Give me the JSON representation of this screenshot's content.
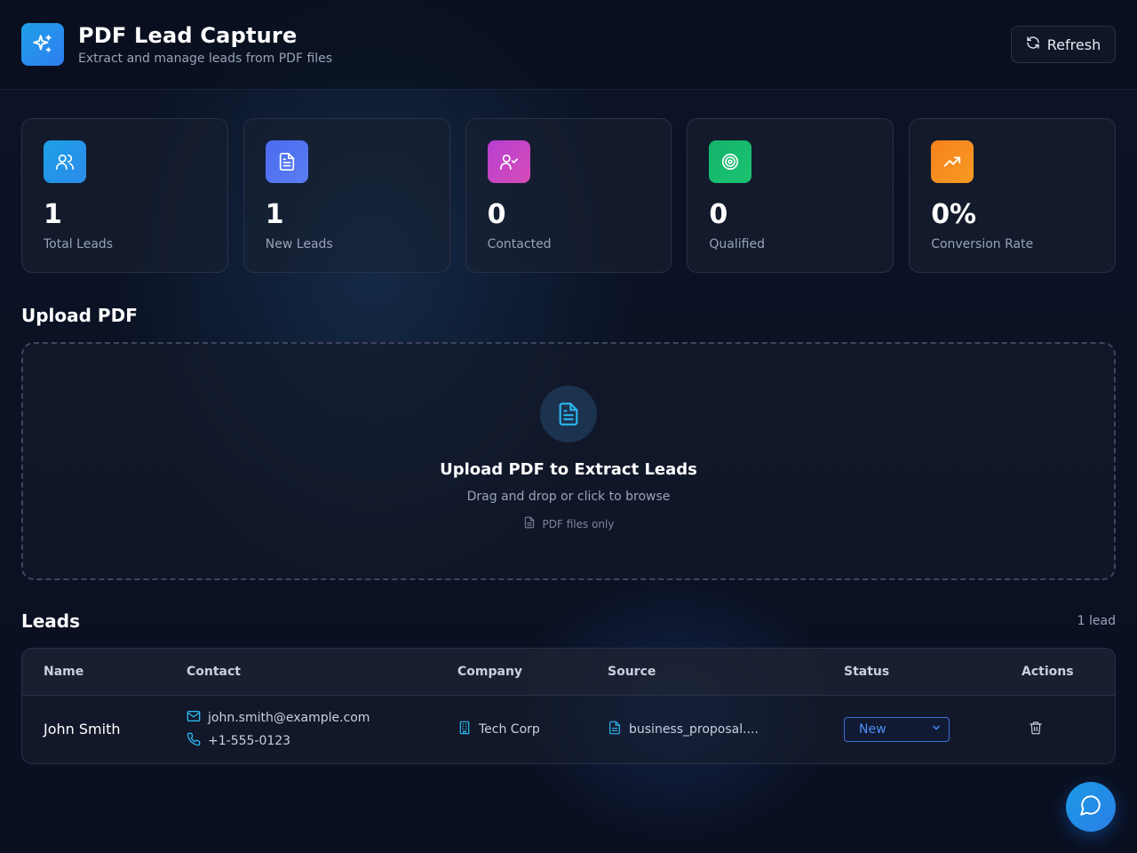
{
  "header": {
    "title": "PDF Lead Capture",
    "subtitle": "Extract and manage leads from PDF files",
    "refresh_label": "Refresh"
  },
  "stats": [
    {
      "value": "1",
      "label": "Total Leads",
      "icon": "users-icon",
      "color": "#1ea0e8"
    },
    {
      "value": "1",
      "label": "New Leads",
      "icon": "file-text-icon",
      "color": "#4f72f0"
    },
    {
      "value": "0",
      "label": "Contacted",
      "icon": "user-check-icon",
      "color": "#c044c8"
    },
    {
      "value": "0",
      "label": "Qualified",
      "icon": "target-icon",
      "color": "#16b866"
    },
    {
      "value": "0%",
      "label": "Conversion Rate",
      "icon": "trending-up-icon",
      "color": "#f7901e"
    }
  ],
  "upload": {
    "section_title": "Upload PDF",
    "title": "Upload PDF to Extract Leads",
    "subtitle": "Drag and drop or click to browse",
    "note": "PDF files only"
  },
  "leads": {
    "section_title": "Leads",
    "count": "1 lead",
    "columns": [
      "Name",
      "Contact",
      "Company",
      "Source",
      "Status",
      "Actions"
    ],
    "rows": [
      {
        "name": "John Smith",
        "email": "john.smith@example.com",
        "phone": "+1-555-0123",
        "company": "Tech Corp",
        "source": "business_proposal....",
        "status": "New"
      }
    ]
  },
  "colors": {
    "accent": "#1ea0e8",
    "status_select": "#4f8ef7"
  }
}
